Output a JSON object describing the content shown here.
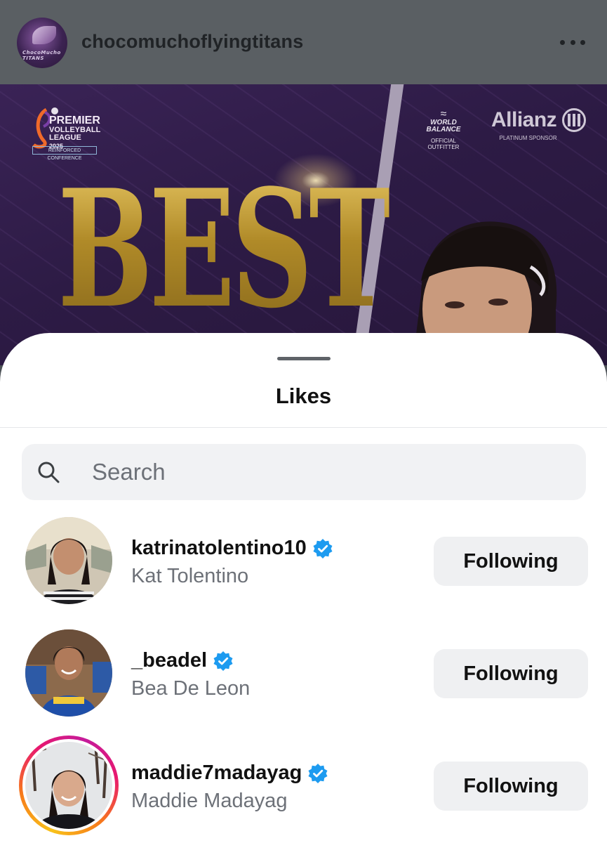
{
  "post": {
    "username": "chocomuchoflyingtitans",
    "avatar_text": "ChocoMucho TITANS",
    "more_icon": "more-horizontal-icon",
    "image": {
      "league_logo_lines": [
        "PREMIER",
        "VOLLEYBALL",
        "LEAGUE",
        "2025",
        "REINFORCED CONFERENCE"
      ],
      "sponsor_1_name": "WORLD BALANCE",
      "sponsor_1_caption": "OFFICIAL OUTFITTER",
      "sponsor_2_name": "Allianz",
      "sponsor_2_caption": "PLATINUM SPONSOR",
      "headline": "BEST"
    }
  },
  "sheet": {
    "title": "Likes",
    "search": {
      "placeholder": "Search",
      "value": "",
      "icon": "search-icon"
    }
  },
  "likes": [
    {
      "username": "katrinatolentino10",
      "full_name": "Kat Tolentino",
      "verified": true,
      "button": "Following",
      "story_ring": false
    },
    {
      "username": "_beadel",
      "full_name": "Bea De Leon",
      "verified": true,
      "button": "Following",
      "story_ring": false
    },
    {
      "username": "maddie7madayag",
      "full_name": "Maddie Madayag",
      "verified": true,
      "button": "Following",
      "story_ring": true
    }
  ],
  "colors": {
    "verified_blue": "#1d9bf0",
    "button_bg": "#eff0f2",
    "secondary_text": "#6d7178",
    "image_purple": "#2d1b45",
    "headline_gold": "#b8912f"
  }
}
